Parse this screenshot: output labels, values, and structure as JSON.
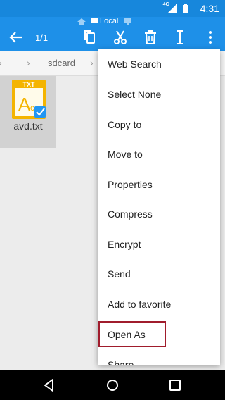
{
  "status_bar": {
    "time": "4:31",
    "network": "4G"
  },
  "toolbar": {
    "location_label": "Local",
    "selection_count": "1/1"
  },
  "breadcrumb": {
    "path": [
      "sdcard"
    ]
  },
  "files": [
    {
      "name": "avd.txt",
      "type_label": "TXT",
      "selected": true
    }
  ],
  "menu": {
    "items": [
      "Web Search",
      "Select None",
      "Copy to",
      "Move to",
      "Properties",
      "Compress",
      "Encrypt",
      "Send",
      "Add to favorite",
      "Open As",
      "Share"
    ],
    "highlighted": "Open As"
  },
  "colors": {
    "status_bar": "#1787dc",
    "toolbar": "#1e90e8",
    "highlight_border": "#a01c2c",
    "file_icon": "#f4b400"
  }
}
